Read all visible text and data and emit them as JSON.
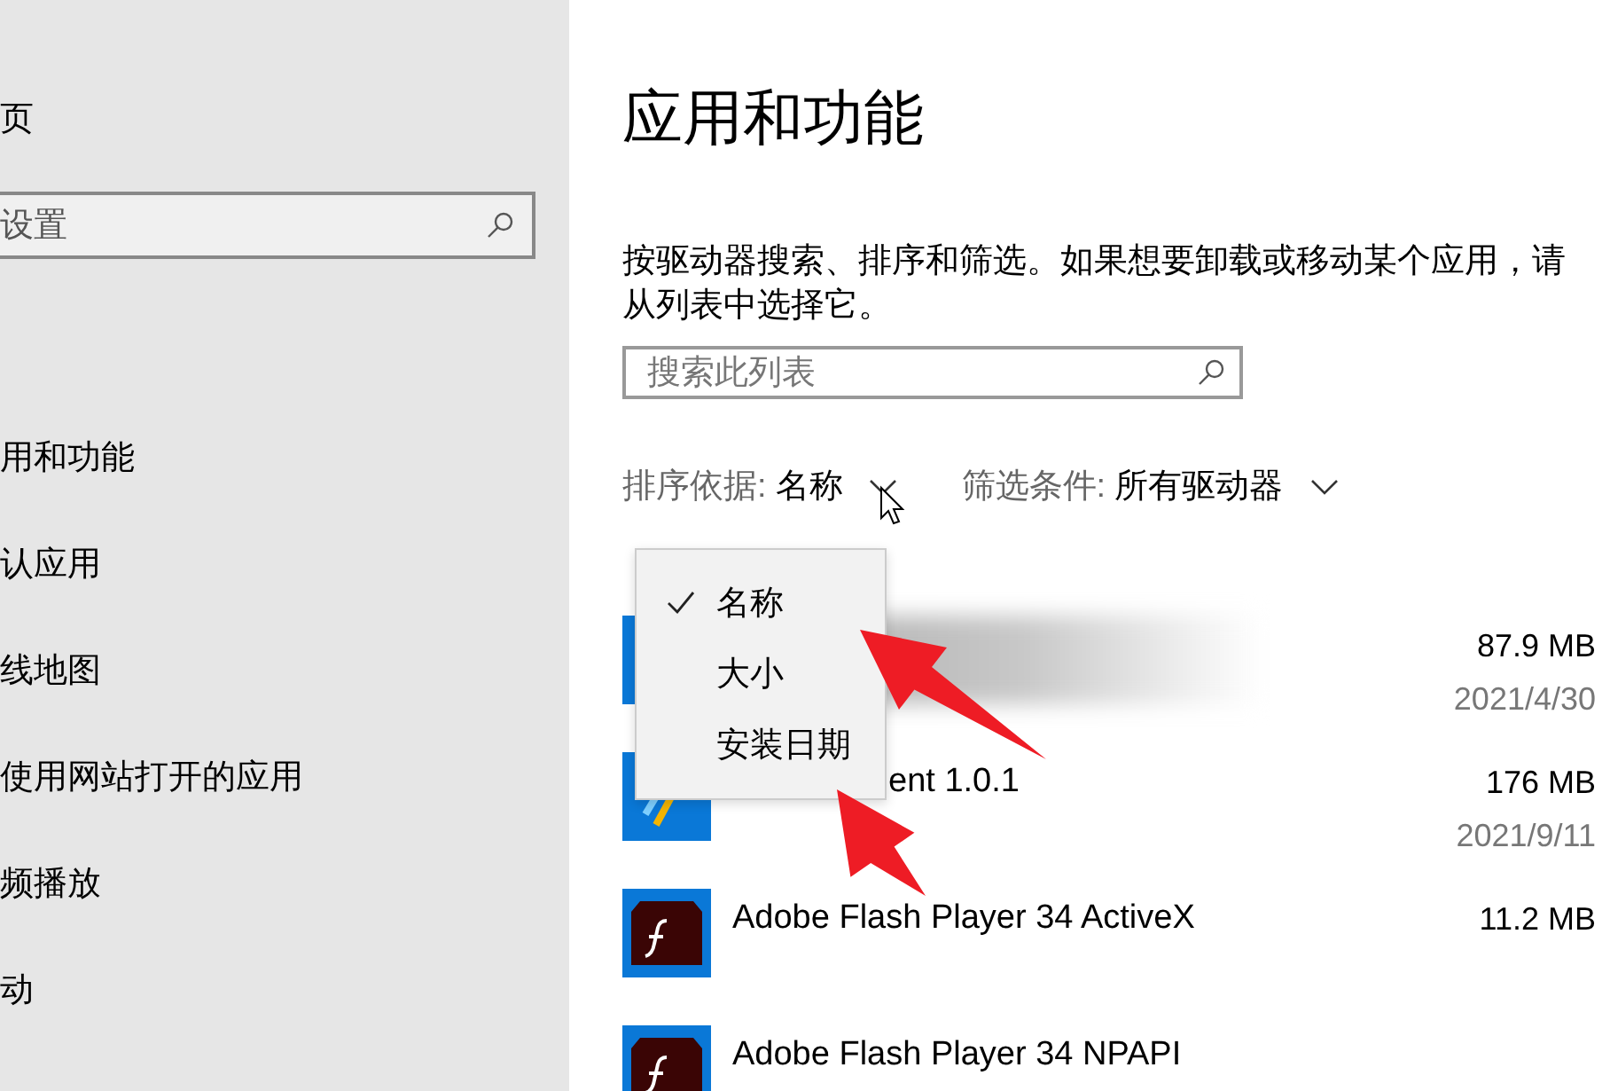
{
  "sidebar": {
    "home": "页",
    "search": {
      "placeholder": "设置"
    },
    "items": [
      {
        "label": "用和功能"
      },
      {
        "label": "认应用"
      },
      {
        "label": "线地图"
      },
      {
        "label": "使用网站打开的应用"
      },
      {
        "label": "频播放"
      },
      {
        "label": "动"
      }
    ]
  },
  "main": {
    "title": "应用和功能",
    "description": "按驱动器搜索、排序和筛选。如果想要卸载或移动某个应用，请从列表中选择它。",
    "search": {
      "placeholder": "搜索此列表"
    },
    "sort": {
      "label": "排序依据:",
      "value": "名称"
    },
    "filter": {
      "label": "筛选条件:",
      "value": "所有驱动器"
    },
    "sort_menu": {
      "items": [
        {
          "label": "名称",
          "selected": true
        },
        {
          "label": "大小",
          "selected": false
        },
        {
          "label": "安装日期",
          "selected": false
        }
      ]
    },
    "apps": [
      {
        "kind": "blurred",
        "size": "87.9 MB",
        "date": "2021/4/30"
      },
      {
        "kind": "covered",
        "name": "ent 1.0.1",
        "size": "176 MB",
        "date": "2021/9/11"
      },
      {
        "kind": "flash",
        "name": "Adobe Flash Player 34 ActiveX",
        "size": "11.2 MB"
      },
      {
        "kind": "flash",
        "name": "Adobe Flash Player 34 NPAPI"
      }
    ]
  }
}
